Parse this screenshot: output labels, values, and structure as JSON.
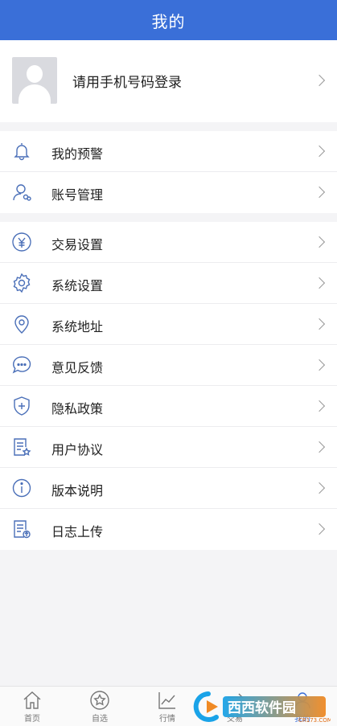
{
  "header": {
    "title": "我的"
  },
  "profile": {
    "login_prompt": "请用手机号码登录"
  },
  "menu_group_1": [
    {
      "label": "我的预警",
      "icon": "bell-icon"
    },
    {
      "label": "账号管理",
      "icon": "user-account-icon"
    }
  ],
  "menu_group_2": [
    {
      "label": "交易设置",
      "icon": "yen-icon"
    },
    {
      "label": "系统设置",
      "icon": "gear-icon"
    },
    {
      "label": "系统地址",
      "icon": "location-pin-icon"
    },
    {
      "label": "意见反馈",
      "icon": "chat-bubble-icon"
    },
    {
      "label": "隐私政策",
      "icon": "shield-plus-icon"
    },
    {
      "label": "用户协议",
      "icon": "document-star-icon"
    },
    {
      "label": "版本说明",
      "icon": "info-icon"
    },
    {
      "label": "日志上传",
      "icon": "document-upload-icon"
    }
  ],
  "tabbar": [
    {
      "label": "首页",
      "icon": "home-icon"
    },
    {
      "label": "自选",
      "icon": "star-icon"
    },
    {
      "label": "行情",
      "icon": "chart-icon"
    },
    {
      "label": "交易",
      "icon": "trade-icon"
    },
    {
      "label": "我的",
      "icon": "user-icon",
      "active": true
    }
  ],
  "watermark": {
    "text": "西西软件园",
    "url_text": "CR173.COM"
  },
  "colors": {
    "accent": "#3a6fd8",
    "background": "#f4f4f6",
    "icon": "#4a6fb8"
  }
}
